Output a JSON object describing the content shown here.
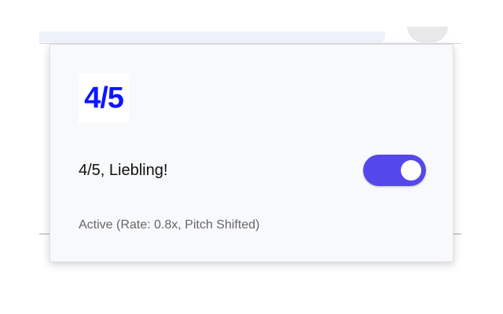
{
  "popup": {
    "logo_text": "4/5",
    "site_label": "4/5, Liebling!",
    "toggle_on": true,
    "status_text": "Active (Rate: 0.8x, Pitch Shifted)"
  },
  "colors": {
    "accent": "#5548ea",
    "logo": "#0e16ff",
    "popup_background": "#f8f9fb",
    "status_text": "#666666"
  }
}
